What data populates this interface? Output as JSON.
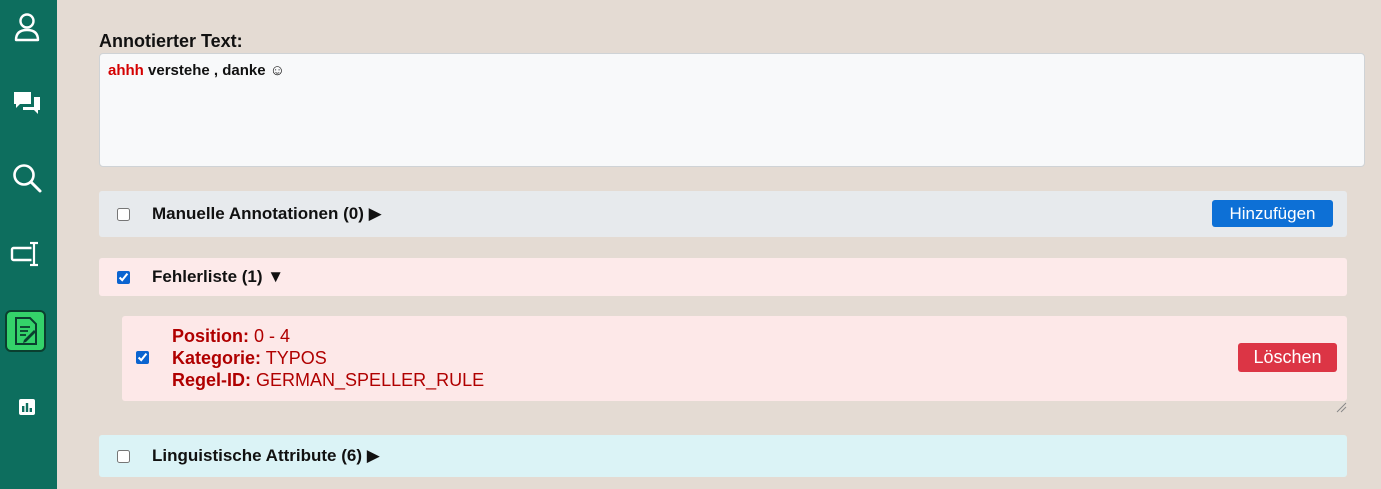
{
  "sidebar": {
    "items": [
      {
        "icon": "user-icon"
      },
      {
        "icon": "chat-icon"
      },
      {
        "icon": "search-icon"
      },
      {
        "icon": "text-cursor-icon"
      },
      {
        "icon": "document-edit-icon",
        "active": true
      },
      {
        "icon": "bar-chart-icon"
      }
    ],
    "accent_color": "#0d6e5e",
    "active_color": "#34d36a"
  },
  "annotated": {
    "label": "Annotierter Text:",
    "error_word": "ahhh",
    "rest_text": " verstehe , danke ☺"
  },
  "manual": {
    "title": "Manuelle Annotationen (0) ▶",
    "checked": false,
    "add_label": "Hinzufügen"
  },
  "errors": {
    "title": "Fehlerliste (1) ▼",
    "checked": true,
    "items": [
      {
        "position_label": "Position:",
        "position_value": "0 - 4",
        "category_label": "Kategorie:",
        "category_value": "TYPOS",
        "rule_label": "Regel-ID:",
        "rule_value": "GERMAN_SPELLER_RULE",
        "checked": true,
        "delete_label": "Löschen"
      }
    ]
  },
  "linguistic": {
    "title": "Linguistische Attribute (6) ▶",
    "checked": false
  }
}
